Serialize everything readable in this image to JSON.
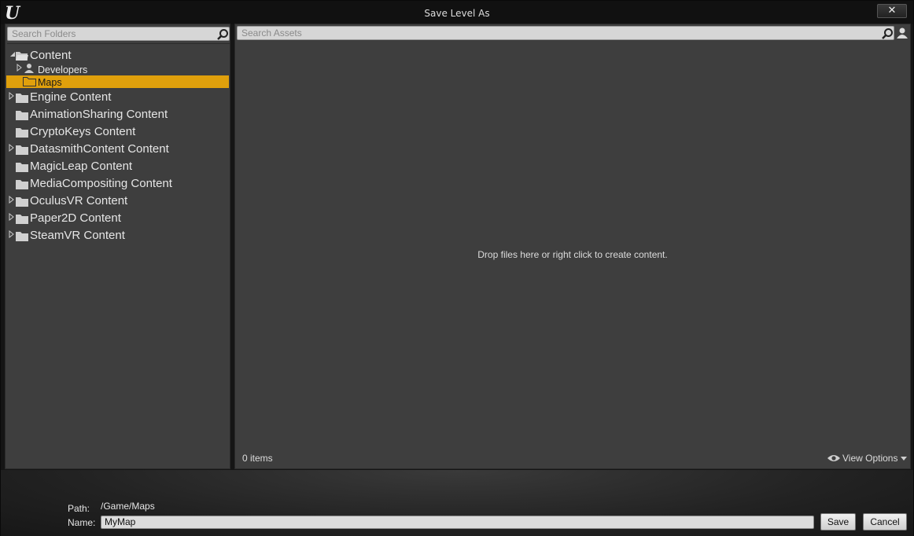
{
  "window": {
    "title": "Save Level As",
    "close_label": "✕"
  },
  "folders_panel": {
    "search_placeholder": "Search Folders",
    "tree": [
      {
        "label": "Content",
        "level": 0,
        "expanded": true,
        "has_children": true
      },
      {
        "label": "Developers",
        "level": 1,
        "expanded": false,
        "has_children": true,
        "icon": "user-icon"
      },
      {
        "label": "Maps",
        "level": 1,
        "selected": true,
        "has_children": false,
        "icon": "folder-open-icon"
      },
      {
        "label": "Engine Content",
        "level": 0,
        "has_children": true
      },
      {
        "label": "AnimationSharing Content",
        "level": 0,
        "has_children": false
      },
      {
        "label": "CryptoKeys Content",
        "level": 0,
        "has_children": false
      },
      {
        "label": "DatasmithContent Content",
        "level": 0,
        "has_children": true
      },
      {
        "label": "MagicLeap Content",
        "level": 0,
        "has_children": false
      },
      {
        "label": "MediaCompositing Content",
        "level": 0,
        "has_children": false
      },
      {
        "label": "OculusVR Content",
        "level": 0,
        "has_children": true
      },
      {
        "label": "Paper2D Content",
        "level": 0,
        "has_children": true
      },
      {
        "label": "SteamVR Content",
        "level": 0,
        "has_children": true
      }
    ]
  },
  "assets_panel": {
    "search_placeholder": "Search Assets",
    "empty_message": "Drop files here or right click to create content.",
    "item_count": "0 items",
    "view_options_label": "View Options"
  },
  "footer": {
    "path_label": "Path:",
    "path_value": "/Game/Maps",
    "name_label": "Name:",
    "name_value": "MyMap",
    "save_label": "Save",
    "cancel_label": "Cancel"
  },
  "colors": {
    "selection": "#e0a00c",
    "panel": "#3e3e3e",
    "background": "#151515"
  }
}
